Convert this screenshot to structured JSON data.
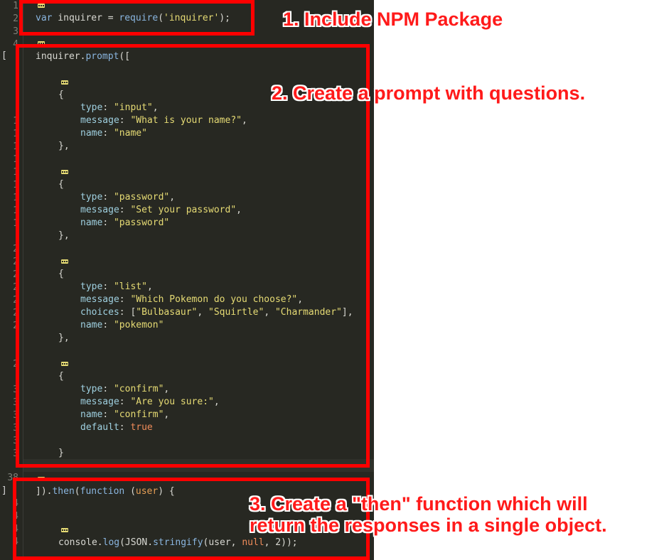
{
  "editor": {
    "gutter": [
      {
        "n": "1"
      },
      {
        "n": "2"
      },
      {
        "n": "3"
      },
      {
        "n": "4"
      },
      {
        "n": "1"
      },
      {
        "n": "1"
      },
      {
        "n": "1"
      },
      {
        "n": "1"
      },
      {
        "n": "1"
      },
      {
        "n": "1"
      },
      {
        "n": "1"
      },
      {
        "n": "1"
      },
      {
        "n": "1"
      },
      {
        "n": "2"
      },
      {
        "n": "2"
      },
      {
        "n": "2"
      },
      {
        "n": "2"
      },
      {
        "n": "2"
      },
      {
        "n": "2"
      },
      {
        "n": "2"
      },
      {
        "n": "2"
      },
      {
        "n": "3"
      },
      {
        "n": "3"
      },
      {
        "n": "3"
      },
      {
        "n": "3"
      },
      {
        "n": "3"
      },
      {
        "n": "3"
      },
      {
        "n": "38"
      },
      {
        "n": "4"
      },
      {
        "n": "4"
      },
      {
        "n": "4"
      },
      {
        "n": "4"
      }
    ],
    "lines": {
      "l2": "var inquirer = require('inquirer');",
      "l5": "inquirer.prompt([",
      "q1_open": "{",
      "q1_type": "type: \"input\",",
      "q1_msg": "message: \"What is your name?\",",
      "q1_name": "name: \"name\"",
      "q1_close": "},",
      "q2_open": "{",
      "q2_type": "type: \"password\",",
      "q2_msg": "message: \"Set your password\",",
      "q2_name": "name: \"password\"",
      "q2_close": "},",
      "q3_open": "{",
      "q3_type": "type: \"list\",",
      "q3_msg": "message: \"Which Pokemon do you choose?\",",
      "q3_choices": "choices: [\"Bulbasaur\", \"Squirtle\", \"Charmander\"],",
      "q3_name": "name: \"pokemon\"",
      "q3_close": "},",
      "q4_open": "{",
      "q4_type": "type: \"confirm\",",
      "q4_msg": "message: \"Are you sure:\",",
      "q4_name": "name: \"confirm\",",
      "q4_default": "default: true",
      "q4_close": "}",
      "then": "]).then(function (user) {",
      "log": "console.log(JSON.stringify(user, null, 2));"
    }
  },
  "annotations": {
    "note1": "1. Include NPM Package",
    "note2": "2. Create a prompt with questions.",
    "note3_line1": "3. Create a \"then\" function which will",
    "note3_line2": "return the responses in a single object."
  },
  "colors": {
    "editor_bg": "#272822",
    "annotation_red": "#ff0000",
    "string": "#e6db74",
    "keyword": "#8ab6e0",
    "boolean": "#f08c5a"
  }
}
